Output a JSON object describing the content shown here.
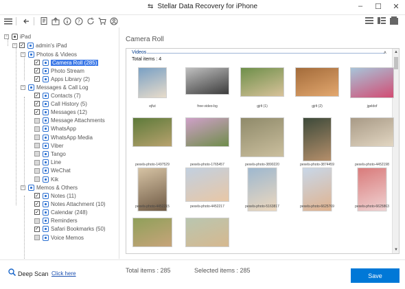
{
  "window": {
    "title": "Stellar Data Recovery for iPhone"
  },
  "tree": {
    "root": "iPad",
    "device": "admin's iPad",
    "groups": [
      {
        "label": "Photos & Videos",
        "items": [
          {
            "label": "Camera Roll (285)",
            "checked": true,
            "selected": true
          },
          {
            "label": "Photo Stream",
            "checked": true
          },
          {
            "label": "Apps Library (2)",
            "checked": true
          }
        ]
      },
      {
        "label": "Messages & Call Log",
        "items": [
          {
            "label": "Contacts (7)",
            "checked": true
          },
          {
            "label": "Call History (5)",
            "checked": true
          },
          {
            "label": "Messages (12)",
            "checked": true
          },
          {
            "label": "Message Attachments",
            "checked": false
          },
          {
            "label": "WhatsApp",
            "checked": false
          },
          {
            "label": "WhatsApp Media",
            "checked": false
          },
          {
            "label": "Viber",
            "checked": false
          },
          {
            "label": "Tango",
            "checked": false
          },
          {
            "label": "Line",
            "checked": false
          },
          {
            "label": "WeChat",
            "checked": false
          },
          {
            "label": "Kik",
            "checked": false
          }
        ]
      },
      {
        "label": "Memos & Others",
        "items": [
          {
            "label": "Notes (11)",
            "checked": true
          },
          {
            "label": "Notes Attachment (10)",
            "checked": true
          },
          {
            "label": "Calendar (248)",
            "checked": true
          },
          {
            "label": "Reminders",
            "checked": false
          },
          {
            "label": "Safari Bookmarks (50)",
            "checked": true
          },
          {
            "label": "Voice Memos",
            "checked": false
          }
        ]
      }
    ]
  },
  "main": {
    "title": "Camera Roll",
    "section": "Videos",
    "total_items": "Total items : 4",
    "photos": [
      {
        "caption": "ejfut"
      },
      {
        "caption": "free-video-bg"
      },
      {
        "caption": "gjrlt (1)"
      },
      {
        "caption": "gjrlt (2)"
      },
      {
        "caption": "jgeldof"
      },
      {
        "caption": "pexels-photo-1497529"
      },
      {
        "caption": "pexels-photo-1765457"
      },
      {
        "caption": "pexels-photo-3890220"
      },
      {
        "caption": "pexels-photo-3874459"
      },
      {
        "caption": "pexels-photo-4452198"
      },
      {
        "caption": "pexels-photo-4452215"
      },
      {
        "caption": "pexels-photo-4452217"
      },
      {
        "caption": "pexels-photo-5163817"
      },
      {
        "caption": "pexels-photo-6625769"
      },
      {
        "caption": "pexels-photo-6625863"
      },
      {
        "caption": ""
      },
      {
        "caption": ""
      }
    ]
  },
  "footer": {
    "deep_scan": "Deep Scan",
    "click_here": "Click here",
    "total_items": "Total items : 285",
    "selected_items": "Selected items : 285",
    "save": "Save"
  },
  "colors": {
    "accent": "#0078d7",
    "selection": "#3b78e7",
    "link": "#1a4fb0"
  },
  "icons": [
    "menu-icon",
    "back-icon",
    "report-icon",
    "export-icon",
    "info-icon",
    "help-icon",
    "refresh-icon",
    "cart-icon",
    "account-icon",
    "list-view-icon",
    "detail-view-icon",
    "thumbnail-view-icon",
    "search-icon"
  ]
}
